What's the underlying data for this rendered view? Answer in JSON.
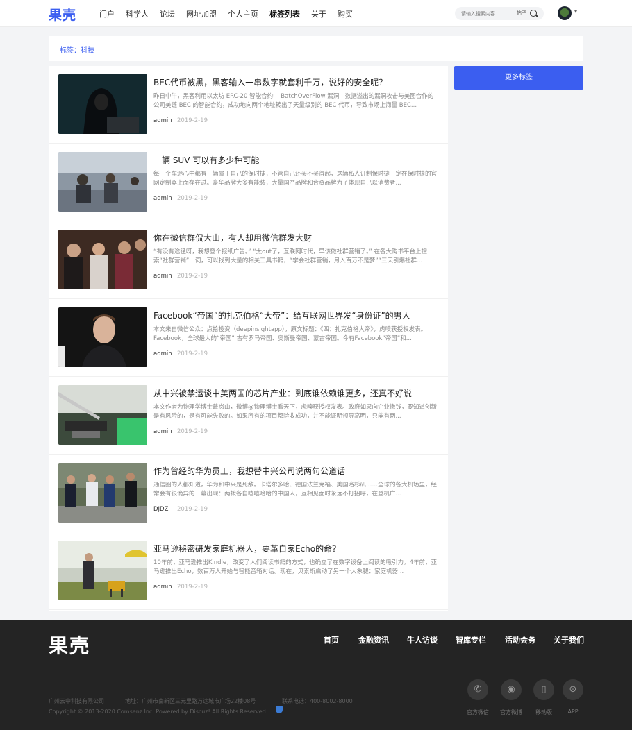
{
  "header": {
    "logo": "果壳",
    "nav": [
      "门户",
      "科学人",
      "论坛",
      "网址加盟",
      "个人主页",
      "标签列表",
      "关于",
      "购买"
    ],
    "active_nav": "标签列表",
    "search_placeholder": "请输入搜索内容",
    "search_scope": "帖子"
  },
  "breadcrumb": "标签：科技",
  "sidebar": {
    "more_tags": "更多标签"
  },
  "articles": [
    {
      "title": "BEC代币被黑，黑客输入一串数字就套利千万，说好的安全呢？",
      "desc": "昨日中午，黑客利用以太坊 ERC-20 智能合约中 BatchOverFlow 漏洞中数据溢出的漏洞攻击与美图合作的公司美链 BEC 的智能合约，成功地向两个地址转出了天量级别的 BEC 代币，导致市场上海量 BEC...",
      "author": "admin",
      "date": "2019-2-19"
    },
    {
      "title": "一辆 SUV 可以有多少种可能",
      "desc": "每一个车迷心中都有一辆属于自己的保时捷，不管自己还买不买得起，这辆私人订制保时捷一定在保时捷的官网定制器上面存在过。豪华品牌大多有能装，大量国产品牌和合资品牌为了体现自己以消费者...",
      "author": "admin",
      "date": "2019-2-19"
    },
    {
      "title": "你在微信群侃大山，有人却用微信群发大财",
      "desc": "“有没有途径呀，我想登个报纸广告。” “太out了，互联网时代，早该做社群营销了。” 在各大购书平台上搜索“社群营销”一词，可以找到大量的相关工具书籍，“学会社群营销，月入百万不是梦”“三天引爆社群...",
      "author": "admin",
      "date": "2019-2-19"
    },
    {
      "title": "Facebook“帝国”的扎克伯格“大帝”：给互联网世界发“身份证”的男人",
      "desc": "本文来自微信公众：点拾投资（deepinsightapp），原文标题：《四：扎克伯格大帝》，虎嗅获授权发表。 Facebook，全球最大的“帝国” 古有罗马帝国、奥斯曼帝国、蒙古帝国。今有Facebook“帝国”和...",
      "author": "admin",
      "date": "2019-2-19"
    },
    {
      "title": "从中兴被禁运谈中美两国的芯片产业：到底谁依赖谁更多，还真不好说",
      "desc": "本文作者为物理学博士戴岚山，微博@物理博士看天下，虎嗅获授权发表。政府如果向企业撒钱，要知道创新是有风险的，是有可能失败的。如果所有的项目都验收成功，并不能证明领导高明，只能有两...",
      "author": "admin",
      "date": "2019-2-19"
    },
    {
      "title": "作为曾经的华为员工，我想替中兴公司说两句公道话",
      "desc": "通信圈的人都知道，华为和中兴是死敌。卡塔尔多哈、德国法兰克福、美国洛杉矶……全球的各大机场里，经常会有很诡异的一幕出现：两拨各自嘻嘻哈哈的中国人，互相见面时永远不打招呼，在登机广...",
      "author": "DJDZ",
      "date": "2019-2-19"
    },
    {
      "title": "亚马逊秘密研发家庭机器人，要革自家Echo的命？",
      "desc": "10年前，亚马逊推出Kindle，改变了人们阅读书籍的方式，也确立了在数字设备上阅读的吸引力。4年前，亚马逊推出Echo，数百万人开始与智能音箱对话。现在，贝索斯启动了另一个大象腿：家庭机器...",
      "author": "admin",
      "date": "2019-2-19"
    }
  ],
  "footer": {
    "logo": "果壳",
    "nav": [
      "首页",
      "金融资讯",
      "牛人访谈",
      "智库专栏",
      "活动会务",
      "关于我们"
    ],
    "company": "广州云中科技有限公司",
    "address": "地址：广州市南新区三元里路万达城市广场22楼08号",
    "phone": "联系电话：400-8002-8000",
    "copyright": "Copyright © 2013-2020  Comsenz Inc.  Powered by Discuz! All Rights Reserved.",
    "social": [
      {
        "label": "官方微信",
        "icon": "wechat-icon"
      },
      {
        "label": "官方微博",
        "icon": "weibo-icon"
      },
      {
        "label": "移动版",
        "icon": "mobile-icon"
      },
      {
        "label": "APP",
        "icon": "app-icon"
      }
    ]
  }
}
